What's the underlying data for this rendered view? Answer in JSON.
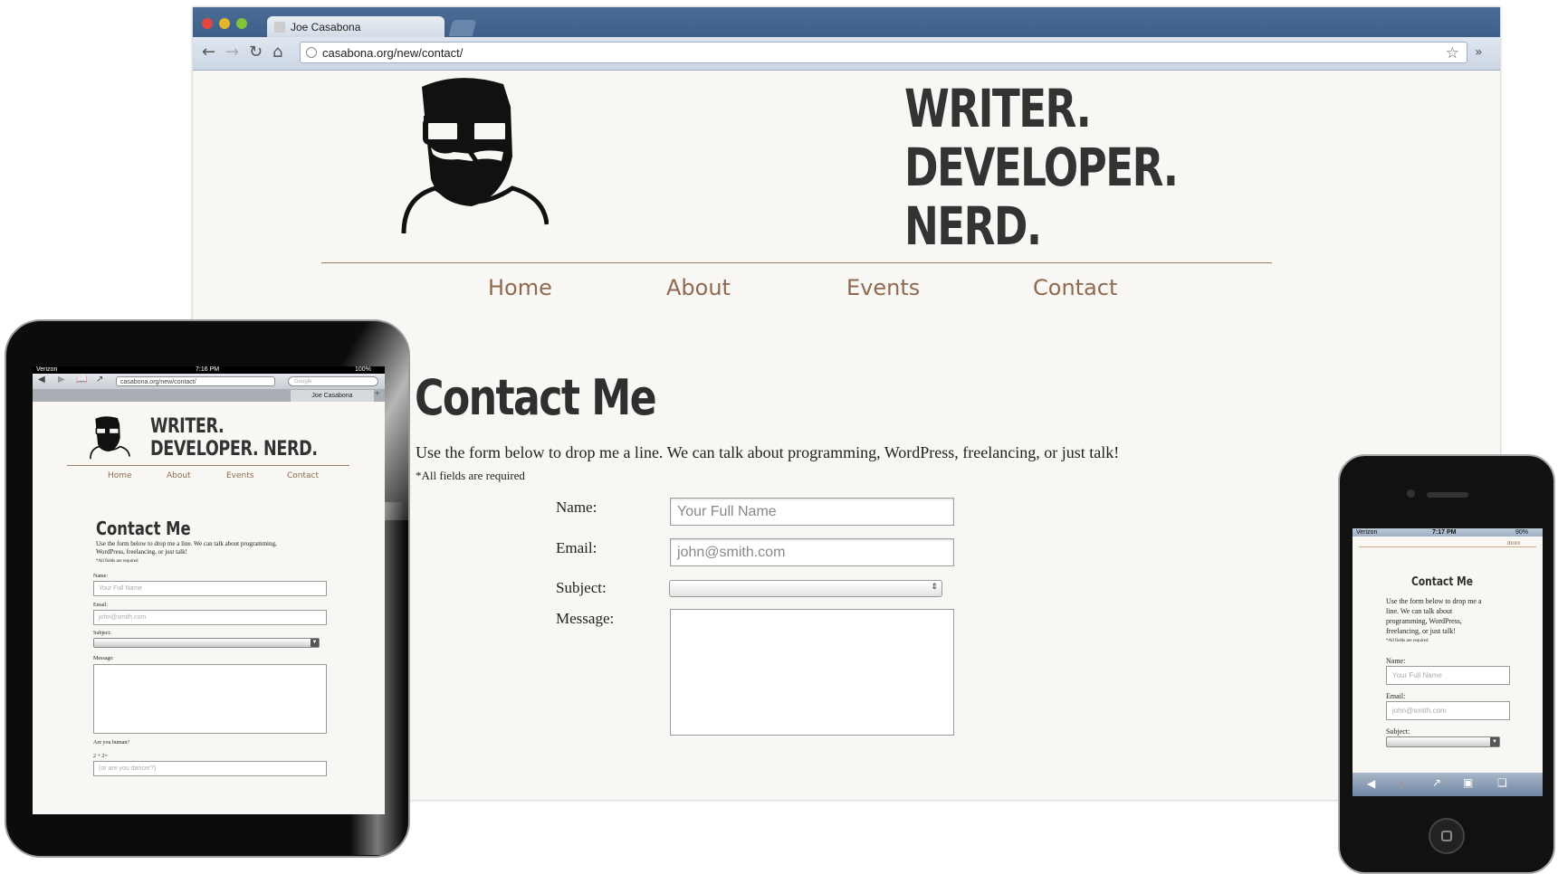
{
  "browser": {
    "tab_title": "Joe Casabona",
    "url": "casabona.org/new/contact/"
  },
  "site": {
    "tagline": [
      "WRITER.",
      "DEVELOPER.",
      "NERD."
    ],
    "nav": [
      "Home",
      "About",
      "Events",
      "Contact"
    ],
    "page_title": "Contact Me",
    "intro": "Use the form below to drop me a line. We can talk about programming, WordPress, freelancing, or just talk!",
    "required_note": "*All fields are required",
    "form": {
      "name_label": "Name:",
      "name_placeholder": "Your Full Name",
      "email_label": "Email:",
      "email_placeholder": "john@smith.com",
      "subject_label": "Subject:",
      "message_label": "Message:"
    }
  },
  "ipad": {
    "carrier": "Verizon",
    "time": "7:16 PM",
    "battery": "100%",
    "url": "casabona.org/new/contact/",
    "search_placeholder": "Google",
    "tab_title": "Joe Casabona",
    "tagline_1": "WRITER.",
    "tagline_2": "DEVELOPER. NERD.",
    "nav": [
      "Home",
      "About",
      "Events",
      "Contact"
    ],
    "page_title": "Contact Me",
    "intro": "Use the form below to drop me a line. We can talk about programming, WordPress, freelancing, or just talk!",
    "required_note": "*All fields are required",
    "name_label": "Name:",
    "name_placeholder": "Your Full Name",
    "email_label": "Email:",
    "email_placeholder": "john@smith.com",
    "subject_label": "Subject:",
    "message_label": "Message:",
    "human_label": "Are you human?",
    "captcha_label": "2 + 2=",
    "captcha_placeholder": "(or are you dancer?)"
  },
  "iphone": {
    "carrier": "Verizon",
    "time": "7:17 PM",
    "battery": "90%",
    "more_link": "more",
    "page_title": "Contact Me",
    "intro": "Use the form below to drop me a line. We can talk about programming, WordPress, freelancing, or just talk!",
    "required_note": "*All fields are required",
    "name_label": "Name:",
    "name_placeholder": "Your Full Name",
    "email_label": "Email:",
    "email_placeholder": "john@smith.com",
    "subject_label": "Subject:"
  }
}
